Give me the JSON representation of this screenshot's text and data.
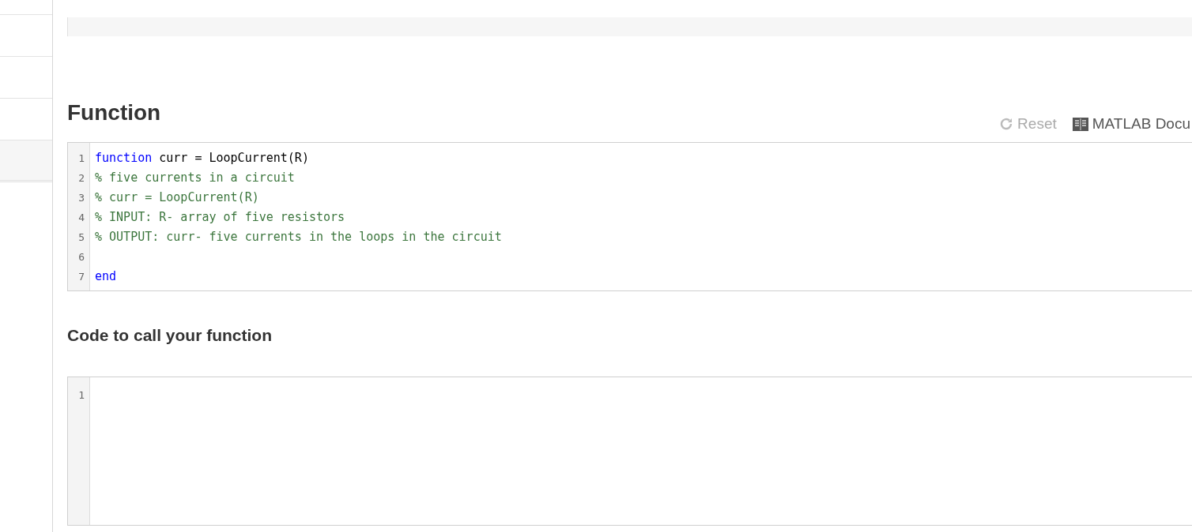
{
  "sidebar": {
    "items": [
      {
        "selected": false
      },
      {
        "selected": false
      },
      {
        "selected": false
      },
      {
        "selected": false
      },
      {
        "selected": true
      }
    ]
  },
  "function_section": {
    "title": "Function",
    "toolbar": [
      {
        "kind": "reset",
        "label": "Reset",
        "disabled": true
      },
      {
        "kind": "doc",
        "label": "MATLAB Docu",
        "disabled": false
      }
    ],
    "editor": {
      "lines": [
        {
          "number": "1",
          "tokens": [
            {
              "kind": "keyword",
              "text": "function"
            },
            {
              "kind": "plain",
              "text": " curr = LoopCurrent(R)"
            }
          ]
        },
        {
          "number": "2",
          "tokens": [
            {
              "kind": "comment",
              "text": "% five currents in a circuit"
            }
          ]
        },
        {
          "number": "3",
          "tokens": [
            {
              "kind": "comment",
              "text": "% curr = LoopCurrent(R)"
            }
          ]
        },
        {
          "number": "4",
          "tokens": [
            {
              "kind": "comment",
              "text": "% INPUT: R- array of five resistors"
            }
          ]
        },
        {
          "number": "5",
          "tokens": [
            {
              "kind": "comment",
              "text": "% OUTPUT: curr- five currents in the loops in the circuit"
            }
          ]
        },
        {
          "number": "6"
        },
        {
          "number": "7",
          "tokens": [
            {
              "kind": "keyword",
              "text": "end"
            }
          ]
        }
      ]
    }
  },
  "call_section": {
    "title": "Code to call your function",
    "editor": {
      "lines": [
        {
          "number": "1"
        }
      ]
    }
  }
}
